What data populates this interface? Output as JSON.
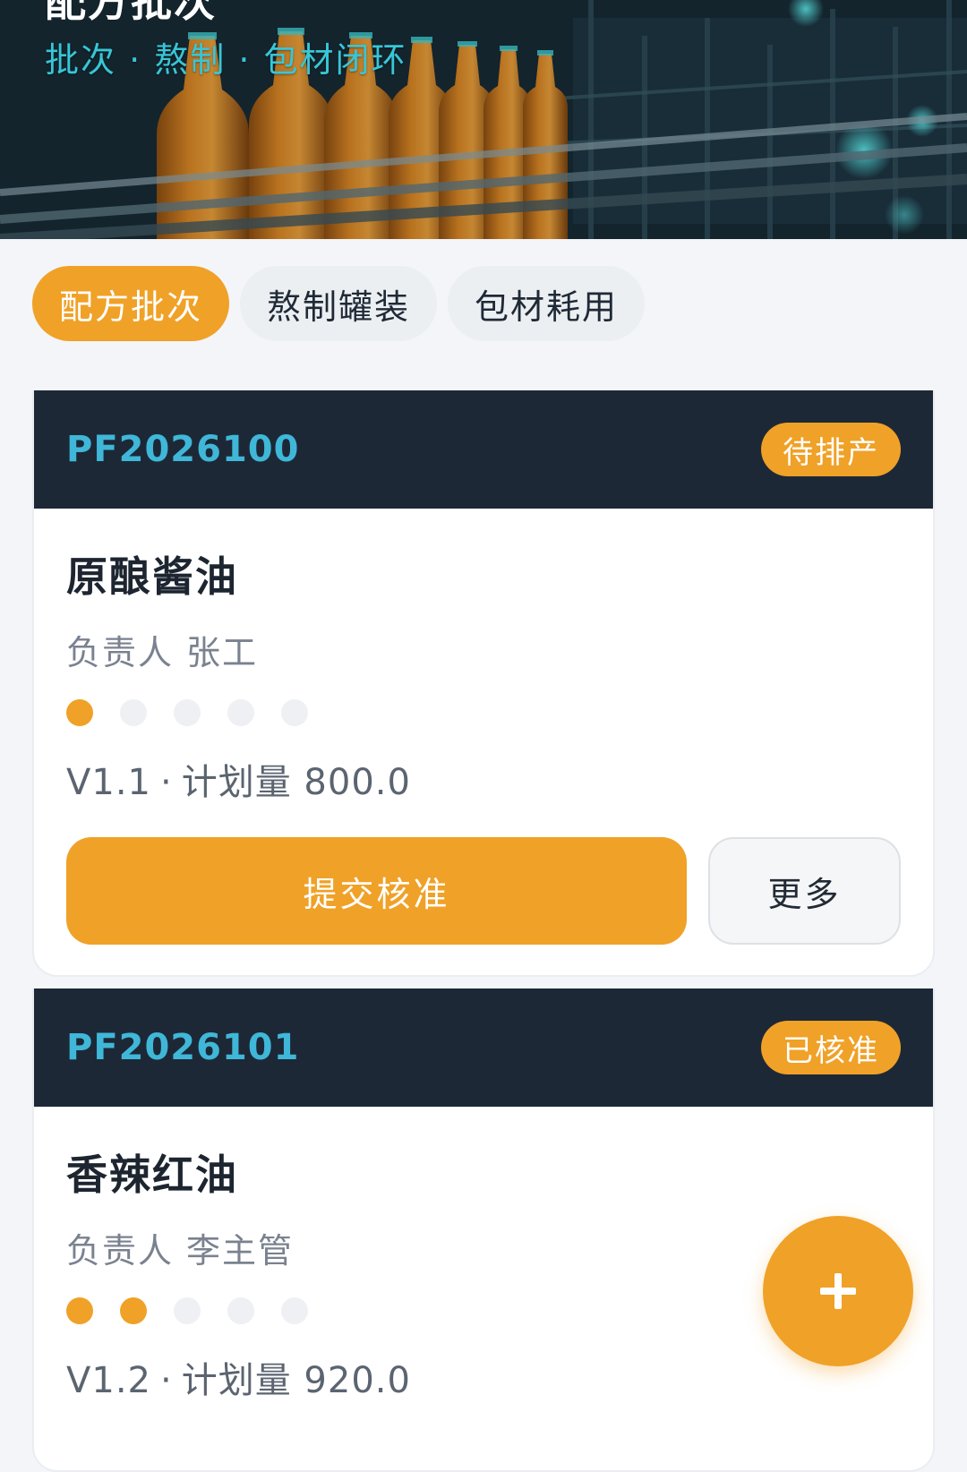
{
  "hero": {
    "title": "配方批次",
    "subtitle": "批次 · 熬制 · 包材闭环"
  },
  "tabs": [
    {
      "label": "配方批次",
      "active": true
    },
    {
      "label": "熬制罐装",
      "active": false
    },
    {
      "label": "包材耗用",
      "active": false
    }
  ],
  "batches": [
    {
      "batch_no": "PF2026100",
      "status": "待排产",
      "product": "原酿酱油",
      "owner_label": "负责人",
      "owner": "张工",
      "steps_total": 5,
      "steps_done": 1,
      "version": "V1.1",
      "plan_label": "计划量",
      "plan_qty": "800.0",
      "primary_action": "提交核准",
      "more_action": "更多"
    },
    {
      "batch_no": "PF2026101",
      "status": "已核准",
      "product": "香辣红油",
      "owner_label": "负责人",
      "owner": "李主管",
      "steps_total": 5,
      "steps_done": 2,
      "version": "V1.2",
      "plan_label": "计划量",
      "plan_qty": "920.0"
    }
  ],
  "fab": {
    "icon": "plus-icon"
  },
  "colors": {
    "accent": "#f0a127",
    "header_dark": "#1d2837",
    "batch_no": "#3fb7d8",
    "subtitle": "#38c6d6",
    "page_bg": "#f3f5f8"
  }
}
